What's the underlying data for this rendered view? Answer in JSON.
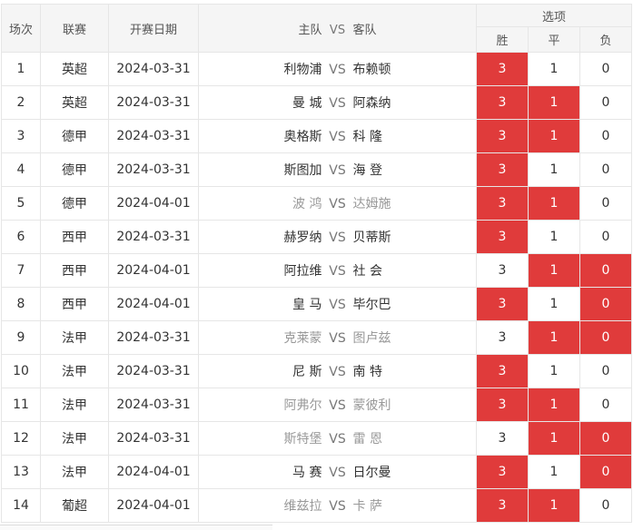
{
  "headers": {
    "no": "场次",
    "league": "联赛",
    "date": "开赛日期",
    "home": "主队",
    "vs": "VS",
    "away": "客队",
    "options": "选项",
    "win": "胜",
    "draw": "平",
    "lose": "负"
  },
  "rows": [
    {
      "no": "1",
      "league": "英超",
      "date": "2024-03-31",
      "home": "利物浦",
      "vs": "VS",
      "away": "布赖顿",
      "win": "3",
      "draw": "1",
      "lose": "0",
      "dim": false,
      "sel": [
        true,
        false,
        false
      ]
    },
    {
      "no": "2",
      "league": "英超",
      "date": "2024-03-31",
      "home": "曼 城",
      "vs": "VS",
      "away": "阿森纳",
      "win": "3",
      "draw": "1",
      "lose": "0",
      "dim": false,
      "sel": [
        true,
        true,
        false
      ]
    },
    {
      "no": "3",
      "league": "德甲",
      "date": "2024-03-31",
      "home": "奥格斯",
      "vs": "VS",
      "away": "科 隆",
      "win": "3",
      "draw": "1",
      "lose": "0",
      "dim": false,
      "sel": [
        true,
        true,
        false
      ]
    },
    {
      "no": "4",
      "league": "德甲",
      "date": "2024-03-31",
      "home": "斯图加",
      "vs": "VS",
      "away": "海 登",
      "win": "3",
      "draw": "1",
      "lose": "0",
      "dim": false,
      "sel": [
        true,
        false,
        false
      ]
    },
    {
      "no": "5",
      "league": "德甲",
      "date": "2024-04-01",
      "home": "波 鸿",
      "vs": "VS",
      "away": "达姆施",
      "win": "3",
      "draw": "1",
      "lose": "0",
      "dim": true,
      "sel": [
        true,
        true,
        false
      ]
    },
    {
      "no": "6",
      "league": "西甲",
      "date": "2024-03-31",
      "home": "赫罗纳",
      "vs": "VS",
      "away": "贝蒂斯",
      "win": "3",
      "draw": "1",
      "lose": "0",
      "dim": false,
      "sel": [
        true,
        false,
        false
      ]
    },
    {
      "no": "7",
      "league": "西甲",
      "date": "2024-04-01",
      "home": "阿拉维",
      "vs": "VS",
      "away": "社 会",
      "win": "3",
      "draw": "1",
      "lose": "0",
      "dim": false,
      "sel": [
        false,
        true,
        true
      ]
    },
    {
      "no": "8",
      "league": "西甲",
      "date": "2024-04-01",
      "home": "皇 马",
      "vs": "VS",
      "away": "毕尔巴",
      "win": "3",
      "draw": "1",
      "lose": "0",
      "dim": false,
      "sel": [
        true,
        false,
        true
      ]
    },
    {
      "no": "9",
      "league": "法甲",
      "date": "2024-03-31",
      "home": "克莱蒙",
      "vs": "VS",
      "away": "图卢兹",
      "win": "3",
      "draw": "1",
      "lose": "0",
      "dim": true,
      "sel": [
        false,
        true,
        true
      ]
    },
    {
      "no": "10",
      "league": "法甲",
      "date": "2024-03-31",
      "home": "尼 斯",
      "vs": "VS",
      "away": "南 特",
      "win": "3",
      "draw": "1",
      "lose": "0",
      "dim": false,
      "sel": [
        true,
        false,
        false
      ]
    },
    {
      "no": "11",
      "league": "法甲",
      "date": "2024-03-31",
      "home": "阿弗尔",
      "vs": "VS",
      "away": "蒙彼利",
      "win": "3",
      "draw": "1",
      "lose": "0",
      "dim": true,
      "sel": [
        true,
        true,
        false
      ]
    },
    {
      "no": "12",
      "league": "法甲",
      "date": "2024-03-31",
      "home": "斯特堡",
      "vs": "VS",
      "away": "雷 恩",
      "win": "3",
      "draw": "1",
      "lose": "0",
      "dim": true,
      "sel": [
        false,
        true,
        true
      ]
    },
    {
      "no": "13",
      "league": "法甲",
      "date": "2024-04-01",
      "home": "马 赛",
      "vs": "VS",
      "away": "日尔曼",
      "win": "3",
      "draw": "1",
      "lose": "0",
      "dim": false,
      "sel": [
        true,
        false,
        true
      ]
    },
    {
      "no": "14",
      "league": "葡超",
      "date": "2024-04-01",
      "home": "维兹拉",
      "vs": "VS",
      "away": "卡 萨",
      "win": "3",
      "draw": "1",
      "lose": "0",
      "dim": true,
      "sel": [
        true,
        true,
        false
      ]
    }
  ]
}
